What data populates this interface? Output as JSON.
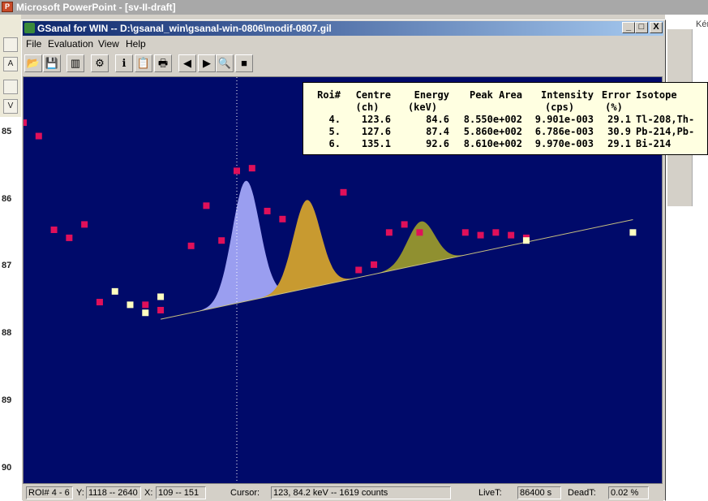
{
  "powerpoint": {
    "title": "Microsoft PowerPoint - [sv-II-draft]",
    "right_label": "Kér",
    "left_tools": [
      "V",
      "A"
    ],
    "ruler_numbers": [
      "85",
      "86",
      "87",
      "88",
      "89",
      "90"
    ]
  },
  "gsanal": {
    "title": "GSanal for WIN -- D:\\gsanal_win\\gsanal-win-0806\\modif-0807.gil",
    "caption_buttons": [
      "_",
      "□",
      "X"
    ],
    "menu": [
      "File",
      "Evaluation",
      "View",
      "Help"
    ],
    "toolbar": [
      {
        "name": "open-icon",
        "glyph": "📂"
      },
      {
        "name": "save-icon",
        "glyph": "💾"
      },
      {
        "name": "columns-icon",
        "glyph": "▥"
      },
      {
        "name": "settings-icon",
        "glyph": "⚙"
      },
      {
        "name": "info-icon",
        "glyph": "ℹ"
      },
      {
        "name": "clipboard-icon",
        "glyph": "📋"
      },
      {
        "name": "print-icon",
        "glyph": "🖶"
      },
      {
        "name": "arrow-left-icon",
        "glyph": "◀"
      },
      {
        "name": "arrow-right-icon",
        "glyph": "▶"
      },
      {
        "name": "zoom-icon",
        "glyph": "🔍"
      },
      {
        "name": "stop-icon",
        "glyph": "■"
      }
    ],
    "colors": {
      "plot_bg": "#000a6a",
      "data_point": "#e0105a",
      "data_point_alt": "#ffffc0",
      "peak_1": "#9a9ef0",
      "peak_2": "#c89a30",
      "peak_3": "#909030",
      "cursor_line": "#ffffff"
    }
  },
  "roi_table": {
    "headers": [
      [
        "Roi#",
        ""
      ],
      [
        "Centre",
        "(ch)"
      ],
      [
        "Energy",
        "(keV)"
      ],
      [
        "Peak Area",
        ""
      ],
      [
        "Intensity",
        "(cps)"
      ],
      [
        "Error",
        "(%)"
      ],
      [
        "Isotope",
        ""
      ]
    ],
    "rows": [
      [
        "4.",
        "123.6",
        "84.6",
        "8.550e+002",
        "9.901e-003",
        "29.1",
        "Tl-208,Th-"
      ],
      [
        "5.",
        "127.6",
        "87.4",
        "5.860e+002",
        "6.786e-003",
        "30.9",
        "Pb-214,Pb-"
      ],
      [
        "6.",
        "135.1",
        "92.6",
        "8.610e+002",
        "9.970e-003",
        "29.1",
        "Bi-214"
      ]
    ]
  },
  "status": {
    "roi": "ROI# 4 - 6",
    "y_label": "Y:",
    "y_value": "1118 -- 2640",
    "x_label": "X:",
    "x_value": "109 -- 151",
    "cursor_label": "Cursor:",
    "cursor_value": "123,   84.2 keV --    1619 counts",
    "livet_label": "LiveT:",
    "livet_value": "86400 s",
    "deadt_label": "DeadT:",
    "deadt_value": "0.02 %"
  },
  "chart_data": {
    "type": "scatter",
    "title": "",
    "xlabel": "",
    "ylabel": "",
    "x_units": "channel",
    "xlim": [
      109,
      151
    ],
    "ylim": [
      1118,
      2640
    ],
    "cursor_x": 123,
    "series": [
      {
        "points": [
          [
            109,
            2470
          ],
          [
            110,
            2420
          ],
          [
            111,
            2070
          ],
          [
            112,
            2040
          ],
          [
            113,
            2090
          ],
          [
            114,
            1800
          ],
          [
            117,
            1790
          ],
          [
            118,
            1770
          ],
          [
            120,
            2010
          ],
          [
            121,
            2160
          ],
          [
            122,
            2030
          ],
          [
            123,
            2290
          ],
          [
            124,
            2300
          ],
          [
            125,
            2140
          ],
          [
            126,
            2110
          ],
          [
            130,
            2210
          ],
          [
            131,
            1920
          ],
          [
            132,
            1940
          ],
          [
            133,
            2060
          ],
          [
            134,
            2090
          ],
          [
            135,
            2060
          ],
          [
            138,
            2060
          ],
          [
            139,
            2050
          ],
          [
            140,
            2060
          ],
          [
            141,
            2050
          ],
          [
            142,
            2040
          ]
        ]
      },
      {
        "points": [
          [
            115,
            1840
          ],
          [
            116,
            1790
          ],
          [
            117,
            1760
          ],
          [
            118,
            1820
          ],
          [
            142,
            2030
          ],
          [
            149,
            2060
          ]
        ]
      }
    ],
    "peaks": [
      {
        "roi": 4,
        "centre": 123.6
      },
      {
        "roi": 5,
        "centre": 127.6
      },
      {
        "roi": 6,
        "centre": 135.1
      }
    ]
  }
}
